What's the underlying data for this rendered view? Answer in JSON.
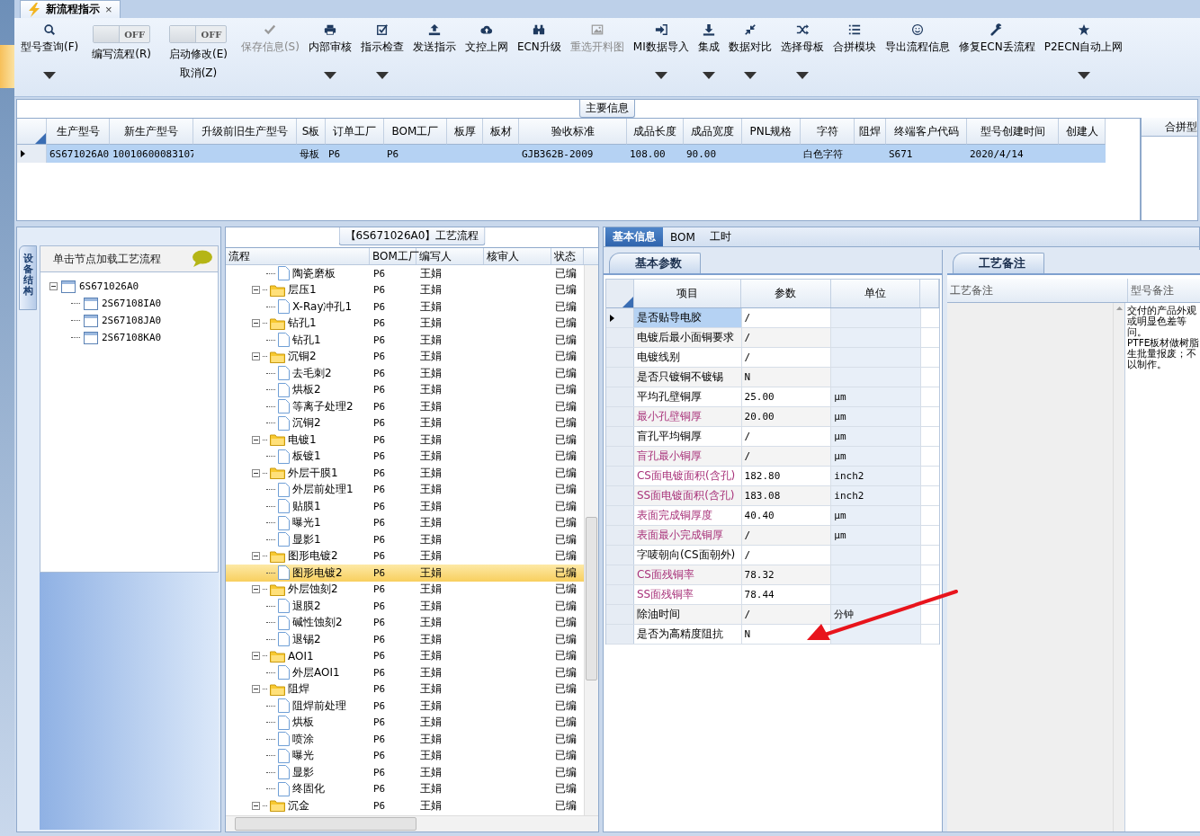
{
  "document_tab": {
    "title": "新流程指示",
    "close": "×"
  },
  "ribbon": [
    {
      "kind": "button",
      "label": "型号查询(F)",
      "disabled": false,
      "dropdown": true
    },
    {
      "kind": "toggle",
      "switch_text": "OFF",
      "on": false,
      "label": "编写流程(R)"
    },
    {
      "kind": "toggle",
      "switch_text": "OFF",
      "on": false,
      "label": "启动修改(E)",
      "sublabel": "取消(Z)"
    },
    {
      "kind": "button",
      "label": "保存信息(S)",
      "disabled": true,
      "dropdown": false
    },
    {
      "kind": "button",
      "label": "内部审核",
      "disabled": false,
      "dropdown": true
    },
    {
      "kind": "button",
      "label": "指示检查",
      "disabled": false,
      "dropdown": true
    },
    {
      "kind": "button",
      "label": "发送指示",
      "disabled": false,
      "dropdown": false
    },
    {
      "kind": "button",
      "label": "文控上网",
      "disabled": false,
      "dropdown": false
    },
    {
      "kind": "button",
      "label": "ECN升级",
      "disabled": false,
      "dropdown": false
    },
    {
      "kind": "button",
      "label": "重选开料图",
      "disabled": true,
      "dropdown": false
    },
    {
      "kind": "button",
      "label": "MI数据导入",
      "disabled": false,
      "dropdown": true
    },
    {
      "kind": "button",
      "label": "集成",
      "disabled": false,
      "dropdown": true
    },
    {
      "kind": "button",
      "label": "数据对比",
      "disabled": false,
      "dropdown": true
    },
    {
      "kind": "button",
      "label": "选择母板",
      "disabled": false,
      "dropdown": true
    },
    {
      "kind": "button",
      "label": "合拼模块",
      "disabled": false,
      "dropdown": false
    },
    {
      "kind": "button",
      "label": "导出流程信息",
      "disabled": false,
      "dropdown": false
    },
    {
      "kind": "button",
      "label": "修复ECN丢流程",
      "disabled": false,
      "dropdown": false
    },
    {
      "kind": "button",
      "label": "P2ECN自动上网",
      "disabled": false,
      "dropdown": true
    }
  ],
  "main_info": {
    "title": "主要信息",
    "columns": [
      "生产型号",
      "新生产型号",
      "升级前旧生产型号",
      "S板",
      "订单工厂",
      "BOM工厂",
      "板厚",
      "板材",
      "验收标准",
      "成品长度",
      "成品宽度",
      "PNL规格",
      "字符",
      "阻焊",
      "终端客户代码",
      "型号创建时间",
      "创建人"
    ],
    "rows": [
      {
        "selected": true,
        "cells": [
          "6S671026A0",
          "10010600083107",
          null,
          "母板",
          "P6",
          "P6",
          null,
          null,
          "GJB362B-2009",
          "108.00",
          "90.00",
          null,
          "白色字符",
          null,
          "S671",
          "2020/4/14",
          null
        ]
      }
    ]
  },
  "merge_panel": {
    "header": "合拼型"
  },
  "structure": {
    "tab": "设备结构",
    "header": "单击节点加载工艺流程",
    "tree": [
      {
        "label": "6S671026A0",
        "expanded": true,
        "children": [
          {
            "label": "2S67108IA0"
          },
          {
            "label": "2S67108JA0"
          },
          {
            "label": "2S67108KA0"
          }
        ]
      }
    ]
  },
  "flow": {
    "title": "【6S671026A0】工艺流程",
    "columns": [
      "流程",
      "BOM工厂",
      "编写人",
      "核审人",
      "状态"
    ],
    "rows": [
      {
        "kind": "step",
        "label": "陶瓷磨板",
        "bom": "P6",
        "writer": "王娟",
        "status": "已编",
        "selected": false
      },
      {
        "kind": "group",
        "label": "层压1",
        "bom": "P6",
        "writer": "王娟",
        "status": "已编",
        "selected": false,
        "expanded": true,
        "children": [
          {
            "kind": "step",
            "label": "X-Ray冲孔1",
            "bom": "P6",
            "writer": "王娟",
            "status": "已编",
            "selected": false
          }
        ]
      },
      {
        "kind": "group",
        "label": "钻孔1",
        "bom": "P6",
        "writer": "王娟",
        "status": "已编",
        "selected": false,
        "expanded": true,
        "children": [
          {
            "kind": "step",
            "label": "钻孔1",
            "bom": "P6",
            "writer": "王娟",
            "status": "已编",
            "selected": false
          }
        ]
      },
      {
        "kind": "group",
        "label": "沉铜2",
        "bom": "P6",
        "writer": "王娟",
        "status": "已编",
        "selected": false,
        "expanded": true,
        "children": [
          {
            "kind": "step",
            "label": "去毛刺2",
            "bom": "P6",
            "writer": "王娟",
            "status": "已编",
            "selected": false
          },
          {
            "kind": "step",
            "label": "烘板2",
            "bom": "P6",
            "writer": "王娟",
            "status": "已编",
            "selected": false
          },
          {
            "kind": "step",
            "label": "等离子处理2",
            "bom": "P6",
            "writer": "王娟",
            "status": "已编",
            "selected": false
          },
          {
            "kind": "step",
            "label": "沉铜2",
            "bom": "P6",
            "writer": "王娟",
            "status": "已编",
            "selected": false
          }
        ]
      },
      {
        "kind": "group",
        "label": "电镀1",
        "bom": "P6",
        "writer": "王娟",
        "status": "已编",
        "selected": false,
        "expanded": true,
        "children": [
          {
            "kind": "step",
            "label": "板镀1",
            "bom": "P6",
            "writer": "王娟",
            "status": "已编",
            "selected": false
          }
        ]
      },
      {
        "kind": "group",
        "label": "外层干膜1",
        "bom": "P6",
        "writer": "王娟",
        "status": "已编",
        "selected": false,
        "expanded": true,
        "children": [
          {
            "kind": "step",
            "label": "外层前处理1",
            "bom": "P6",
            "writer": "王娟",
            "status": "已编",
            "selected": false
          },
          {
            "kind": "step",
            "label": "贴膜1",
            "bom": "P6",
            "writer": "王娟",
            "status": "已编",
            "selected": false
          },
          {
            "kind": "step",
            "label": "曝光1",
            "bom": "P6",
            "writer": "王娟",
            "status": "已编",
            "selected": false
          },
          {
            "kind": "step",
            "label": "显影1",
            "bom": "P6",
            "writer": "王娟",
            "status": "已编",
            "selected": false
          }
        ]
      },
      {
        "kind": "group",
        "label": "图形电镀2",
        "bom": "P6",
        "writer": "王娟",
        "status": "已编",
        "selected": false,
        "expanded": true,
        "children": [
          {
            "kind": "step",
            "label": "图形电镀2",
            "bom": "P6",
            "writer": "王娟",
            "status": "已编",
            "selected": true
          }
        ]
      },
      {
        "kind": "group",
        "label": "外层蚀刻2",
        "bom": "P6",
        "writer": "王娟",
        "status": "已编",
        "selected": false,
        "expanded": true,
        "children": [
          {
            "kind": "step",
            "label": "退膜2",
            "bom": "P6",
            "writer": "王娟",
            "status": "已编",
            "selected": false
          },
          {
            "kind": "step",
            "label": "碱性蚀刻2",
            "bom": "P6",
            "writer": "王娟",
            "status": "已编",
            "selected": false
          },
          {
            "kind": "step",
            "label": "退锡2",
            "bom": "P6",
            "writer": "王娟",
            "status": "已编",
            "selected": false
          }
        ]
      },
      {
        "kind": "group",
        "label": "AOI1",
        "bom": "P6",
        "writer": "王娟",
        "status": "已编",
        "selected": false,
        "expanded": true,
        "children": [
          {
            "kind": "step",
            "label": "外层AOI1",
            "bom": "P6",
            "writer": "王娟",
            "status": "已编",
            "selected": false
          }
        ]
      },
      {
        "kind": "group",
        "label": "阻焊",
        "bom": "P6",
        "writer": "王娟",
        "status": "已编",
        "selected": false,
        "expanded": true,
        "children": [
          {
            "kind": "step",
            "label": "阻焊前处理",
            "bom": "P6",
            "writer": "王娟",
            "status": "已编",
            "selected": false
          },
          {
            "kind": "step",
            "label": "烘板",
            "bom": "P6",
            "writer": "王娟",
            "status": "已编",
            "selected": false
          },
          {
            "kind": "step",
            "label": "喷涂",
            "bom": "P6",
            "writer": "王娟",
            "status": "已编",
            "selected": false
          },
          {
            "kind": "step",
            "label": "曝光",
            "bom": "P6",
            "writer": "王娟",
            "status": "已编",
            "selected": false
          },
          {
            "kind": "step",
            "label": "显影",
            "bom": "P6",
            "writer": "王娟",
            "status": "已编",
            "selected": false
          },
          {
            "kind": "step",
            "label": "终固化",
            "bom": "P6",
            "writer": "王娟",
            "status": "已编",
            "selected": false
          }
        ]
      },
      {
        "kind": "group",
        "label": "沉金",
        "bom": "P6",
        "writer": "王娟",
        "status": "已编",
        "selected": false,
        "expanded": true,
        "children": []
      }
    ]
  },
  "detail": {
    "tabs": [
      {
        "label": "基本信息",
        "selected": true
      },
      {
        "label": "BOM",
        "selected": false
      },
      {
        "label": "工时",
        "selected": false
      }
    ],
    "params": {
      "tab": "基本参数",
      "columns": [
        "项目",
        "参数",
        "单位"
      ],
      "rows": [
        {
          "item": "是否贴导电胶",
          "value": "/",
          "emphasis": false,
          "selected": true
        },
        {
          "item": "电镀后最小面铜要求",
          "value": "/",
          "emphasis": false,
          "selected": false
        },
        {
          "item": "电镀线别",
          "value": "/",
          "emphasis": false,
          "selected": false
        },
        {
          "item": "是否只镀铜不镀锡",
          "value": "N",
          "emphasis": false,
          "selected": false
        },
        {
          "item": "平均孔壁铜厚",
          "value": "25.00",
          "unit": "μm",
          "emphasis": false,
          "selected": false
        },
        {
          "item": "最小孔壁铜厚",
          "value": "20.00",
          "unit": "μm",
          "emphasis": true,
          "selected": false
        },
        {
          "item": "盲孔平均铜厚",
          "value": "/",
          "unit": "μm",
          "emphasis": false,
          "selected": false
        },
        {
          "item": "盲孔最小铜厚",
          "value": "/",
          "unit": "μm",
          "emphasis": true,
          "selected": false
        },
        {
          "item": "CS面电镀面积(含孔)",
          "value": "182.80",
          "unit": "inch2",
          "emphasis": true,
          "selected": false
        },
        {
          "item": "SS面电镀面积(含孔)",
          "value": "183.08",
          "unit": "inch2",
          "emphasis": true,
          "selected": false
        },
        {
          "item": "表面完成铜厚度",
          "value": "40.40",
          "unit": "μm",
          "emphasis": true,
          "selected": false
        },
        {
          "item": "表面最小完成铜厚",
          "value": "/",
          "unit": "μm",
          "emphasis": true,
          "selected": false
        },
        {
          "item": "字唛朝向(CS面朝外)",
          "value": "/",
          "emphasis": false,
          "selected": false
        },
        {
          "item": "CS面残铜率",
          "value": "78.32",
          "emphasis": true,
          "selected": false
        },
        {
          "item": "SS面残铜率",
          "value": "78.44",
          "emphasis": true,
          "selected": false
        },
        {
          "item": "除油时间",
          "value": "/",
          "unit": "分钟",
          "emphasis": false,
          "selected": false
        },
        {
          "item": "是否为高精度阻抗",
          "value": "N",
          "emphasis": false,
          "selected": false
        }
      ]
    },
    "notes": {
      "tab": "工艺备注",
      "columns": [
        "工艺备注",
        "型号备注"
      ],
      "model_note": [
        "交付的产品外观或明显色差等问。",
        "PTFE板材做树脂生批量报废；不以制作。"
      ]
    }
  },
  "annotation_arrow": true
}
